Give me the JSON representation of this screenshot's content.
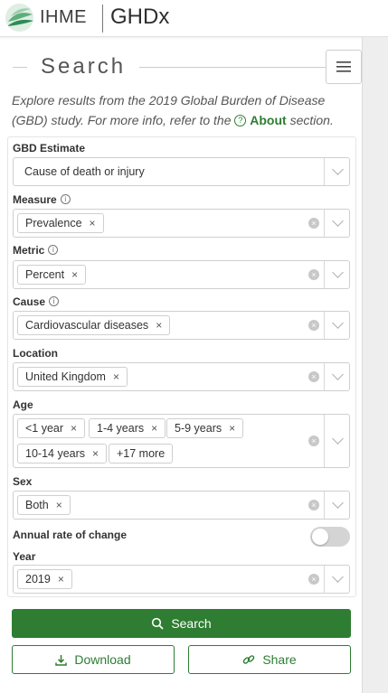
{
  "header": {
    "brand": "IHME",
    "product": "GHDx"
  },
  "search": {
    "title": "Search",
    "intro_text": "Explore results from the 2019 Global Burden of Disease (GBD) study. For more info, refer to the",
    "about_link": "About",
    "intro_suffix": "section."
  },
  "form": {
    "gbd_estimate": {
      "label": "GBD Estimate",
      "value": "Cause of death or injury"
    },
    "measure": {
      "label": "Measure",
      "tags": [
        "Prevalence"
      ]
    },
    "metric": {
      "label": "Metric",
      "tags": [
        "Percent"
      ]
    },
    "cause": {
      "label": "Cause",
      "tags": [
        "Cardiovascular diseases"
      ]
    },
    "location": {
      "label": "Location",
      "tags": [
        "United Kingdom"
      ]
    },
    "age": {
      "label": "Age",
      "tags": [
        "<1 year",
        "1-4 years",
        "5-9 years",
        "10-14 years"
      ],
      "more": "+17 more"
    },
    "sex": {
      "label": "Sex",
      "tags": [
        "Both"
      ]
    },
    "annual_rate": {
      "label": "Annual rate of change",
      "enabled": false
    },
    "year": {
      "label": "Year",
      "tags": [
        "2019"
      ]
    }
  },
  "buttons": {
    "search": "Search",
    "download": "Download",
    "share": "Share"
  },
  "colors": {
    "primary_green": "#2e7d32"
  }
}
